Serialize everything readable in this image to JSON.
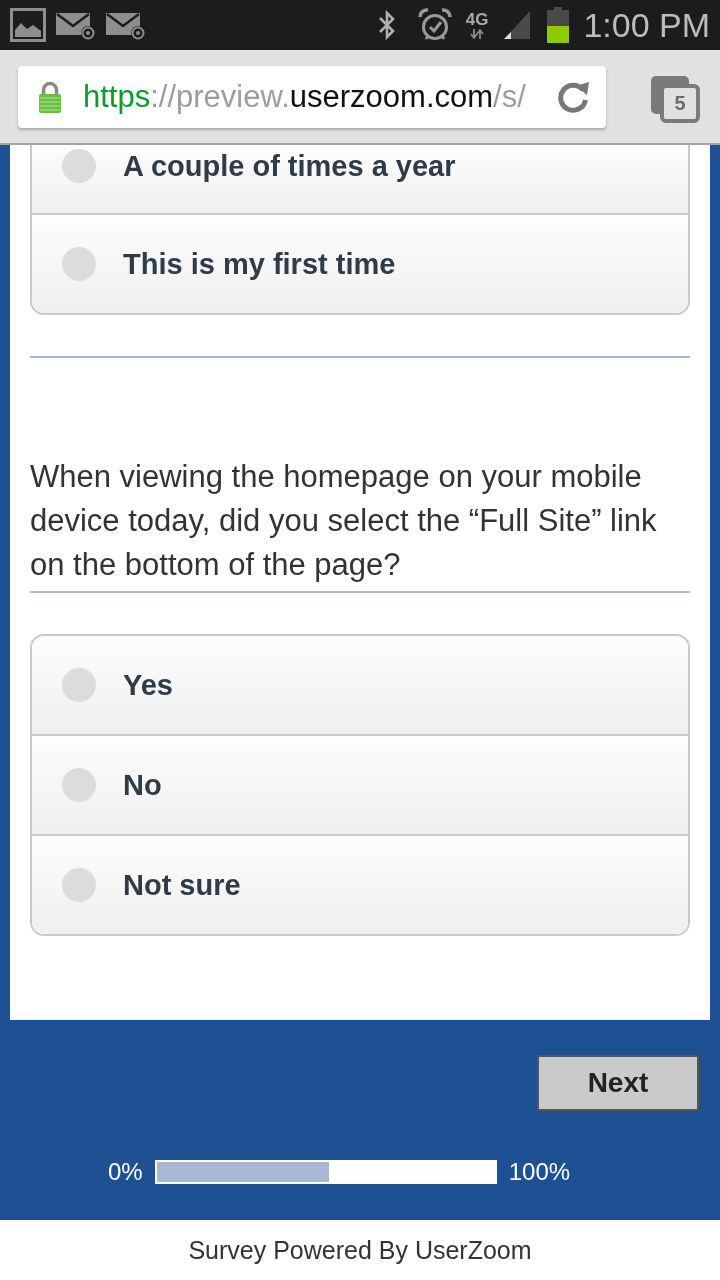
{
  "status_bar": {
    "network": "4G",
    "time": "1:00 PM"
  },
  "browser": {
    "url_parts": [
      {
        "text": "https",
        "kind": "scheme"
      },
      {
        "text": "://preview.",
        "kind": "muted"
      },
      {
        "text": "userzoom.com",
        "kind": "domain"
      },
      {
        "text": "/s/",
        "kind": "muted"
      }
    ],
    "tab_count": "5"
  },
  "questions": [
    {
      "cut_off_top": true,
      "options": [
        {
          "label": "A couple of times a year",
          "selected": false
        },
        {
          "label": "This is my first time",
          "selected": false
        }
      ]
    },
    {
      "cut_off_top": false,
      "text": "When viewing the homepage on your mobile device today, did you select the “Full Site” link on the bottom of the page?",
      "options": [
        {
          "label": "Yes",
          "selected": false
        },
        {
          "label": "No",
          "selected": false
        },
        {
          "label": "Not sure",
          "selected": false
        }
      ]
    }
  ],
  "next_button": "Next",
  "progress": {
    "start_label": "0%",
    "level": 0.51,
    "end_label": "100%"
  },
  "footer": "Survey Powered By UserZoom"
}
